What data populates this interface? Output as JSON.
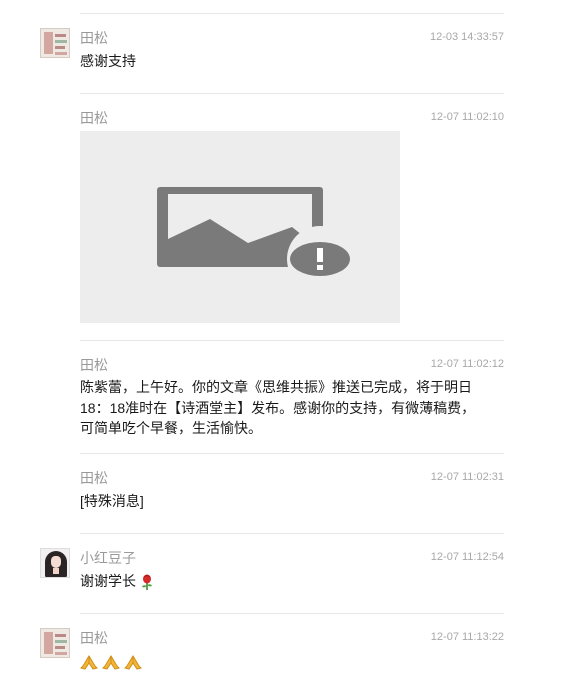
{
  "messages": [
    {
      "sender": "田松",
      "time": "12-03 14:33:57",
      "text": "感谢支持"
    },
    {
      "sender": "田松",
      "time": "12-07 11:02:10",
      "image_status": "image-load-failed"
    },
    {
      "sender": "田松",
      "time": "12-07 11:02:12",
      "lines": [
        "陈紫蕾，上午好。你的文章《思维共振》推送已完成，将于明日",
        "18：18准时在【诗酒堂主】发布。感谢你的支持，有微薄稿费，",
        "可简单吃个早餐，生活愉快。"
      ]
    },
    {
      "sender": "田松",
      "time": "12-07 11:02:31",
      "text": "[特殊消息]"
    },
    {
      "sender": "小红豆子",
      "time": "12-07 11:12:54",
      "text": "谢谢学长",
      "emoji": "rose-icon"
    },
    {
      "sender": "田松",
      "time": "12-07 11:13:22",
      "emoji": "folded-hands-icon",
      "emoji_count": 3
    }
  ],
  "colors": {
    "name": "#9a9a9a",
    "time": "#a8a8a8",
    "text": "#1a1a1a",
    "divider": "#e7e7e7",
    "placeholder_bg": "#ededed",
    "placeholder_icon": "#7a7a7a"
  }
}
